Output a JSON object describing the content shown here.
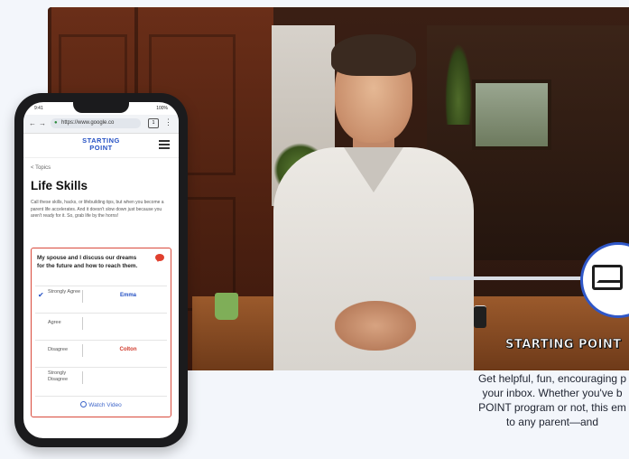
{
  "video": {
    "brand_label": "STARTING POINT",
    "description_lines": [
      "Get helpful, fun, encouraging p",
      "your inbox. Whether you've b",
      "POINT program or not, this em",
      "to any parent—and"
    ]
  },
  "phone": {
    "status_time": "9:41",
    "status_battery": "100%",
    "browser": {
      "back_icon": "←",
      "forward_icon": "→",
      "url": "https://www.google.co",
      "tabs_count": "1",
      "more_icon": "⋮"
    },
    "site": {
      "logo_line1": "STARTING",
      "logo_line2": "POINT"
    },
    "page": {
      "back_link": "< Topics",
      "title": "Life Skills",
      "intro": "Call these skills, hacks, or lifebuilding tips, but when you become a parent life accelerates. And it doesn't slow down just because you aren't ready for it. So, grab life by the horns!"
    },
    "card": {
      "question": "My spouse and I discuss our dreams for the future and how to reach them.",
      "rows": [
        {
          "label": "Strongly Agree",
          "name": "Emma",
          "checked": true
        },
        {
          "label": "Agree",
          "name": ""
        },
        {
          "label": "Disagree",
          "name": "Colton"
        },
        {
          "label": "Strongly Disagree",
          "name": ""
        }
      ],
      "watch_video": "Watch Video"
    }
  },
  "colors": {
    "brand_blue": "#2551c4",
    "accent_red": "#d94a3c",
    "emma_blue": "#2551c4",
    "colton_red": "#d1392a"
  }
}
